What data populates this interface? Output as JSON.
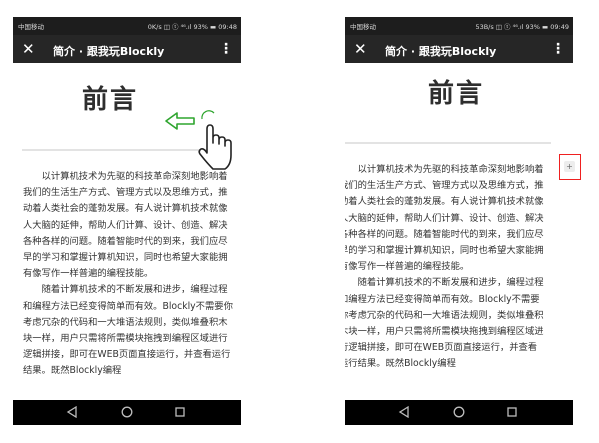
{
  "screens": [
    {
      "status": {
        "carrier": "中国移动",
        "right": "0K/s ◫ ⓣ ⁴⁶.ıl 93% ▬ 09:48"
      },
      "appbar": {
        "close_icon": "close-x-icon",
        "title": "简介 · 跟我玩Blockly",
        "more_icon": "more-vert-icon"
      },
      "heading": "前言",
      "paragraphs": [
        "以计算机技术为先驱的科技革命深刻地影响着我们的生活生产方式、管理方式以及思维方式，推动着人类社会的蓬勃发展。有人说计算机技术就像人大脑的延伸，帮助人们计算、设计、创造、解决各种各样的问题。随着智能时代的到来，我们应尽早的学习和掌握计算机知识，同时也希望大家能拥有像写作一样普遍的编程技能。",
        "随着计算机技术的不断发展和进步，编程过程和编程方法已经变得简单而有效。Blockly不需要你考虑冗杂的代码和一大堆语法规则，类似堆叠积木块一样，用户只需将所需模块拖拽到编程区域进行逻辑拼接，即可在WEB页面直接运行，并查看运行结果。既然Blockly编程"
      ],
      "gesture": {
        "arrow_icon": "left-arrow-icon",
        "hand_icon": "hand-swipe-icon"
      },
      "nav": {
        "back_icon": "back-triangle-icon",
        "home_icon": "home-circle-icon",
        "recent_icon": "recent-square-icon"
      }
    },
    {
      "status": {
        "carrier": "中国移动",
        "right": "53B/s ◫ ⓣ ⁴⁶.ıl 93% ▬ 09:49"
      },
      "appbar": {
        "close_icon": "close-x-icon",
        "title": "简介 · 跟我玩Blockly",
        "more_icon": "more-vert-icon"
      },
      "heading": "前言",
      "paragraphs": [
        "以计算机技术为先驱的科技革命深刻地影响着我们的生活生产方式、管理方式以及思维方式，推动着人类社会的蓬勃发展。有人说计算机技术就像人大脑的延伸，帮助人们计算、设计、创造、解决各种各样的问题。随着智能时代的到来，我们应尽早的学习和掌握计算机知识，同时也希望大家能拥有像写作一样普遍的编程技能。",
        "随着计算机技术的不断发展和进步，编程过程和编程方法已经变得简单而有效。Blockly不需要你考虑冗杂的代码和一大堆语法规则，类似堆叠积木块一样，用户只需将所需模块拖拽到编程区域进行逻辑拼接，即可在WEB页面直接运行，并查看运行结果。既然Blockly编程"
      ],
      "nav": {
        "back_icon": "back-triangle-icon",
        "home_icon": "home-circle-icon",
        "recent_icon": "recent-square-icon"
      }
    }
  ],
  "expand_button": {
    "label": "+",
    "highlight_color": "#ef2020"
  }
}
